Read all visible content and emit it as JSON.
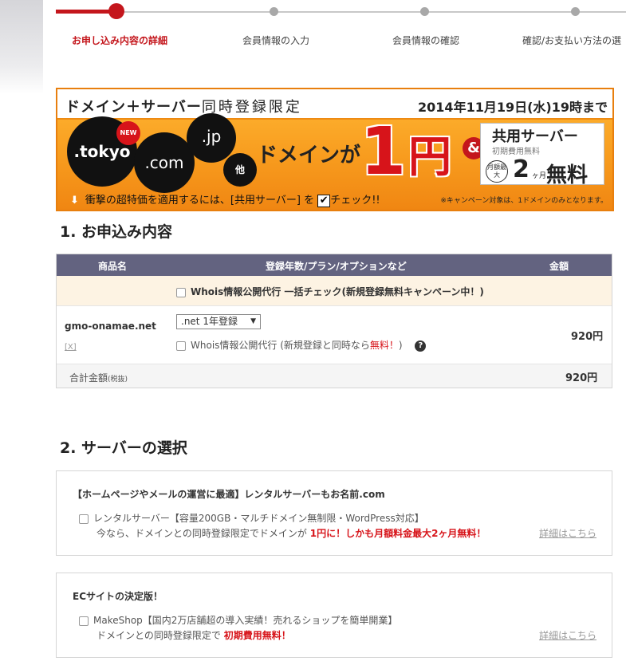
{
  "steps": [
    {
      "label": "お申し込み内容の詳細",
      "active": true
    },
    {
      "label": "会員情報の入力",
      "active": false
    },
    {
      "label": "会員情報の確認",
      "active": false
    },
    {
      "label": "確認/お支払い方法の選",
      "active": false
    }
  ],
  "banner": {
    "headline": "ドメイン＋サーバー",
    "limited": "同時登録限定",
    "date": "2014年11月19日(水)19時まで",
    "new_badge": "NEW",
    "tlds": [
      ".tokyo",
      ".com",
      ".jp",
      "他"
    ],
    "domain_ga": "ドメインが",
    "price_one": "1",
    "price_yen": "円",
    "amp": "&",
    "server_title": "共用サーバー",
    "server_sub": "初期費用無料",
    "monthly": "月額最大",
    "two": "2",
    "months": "ヶ月",
    "free": "無料",
    "bottom_text": "衝撃の超特価を適用するには、[共用サーバー] を",
    "check_text": "チェック!!",
    "note": "※キャンペーン対象は、1ドメインのみとなります。"
  },
  "section1": {
    "title": "1. お申込み内容",
    "headers": {
      "product": "商品名",
      "plan": "登録年数/プラン/オプションなど",
      "price": "金額"
    },
    "bulk_label": "Whois情報公開代行 一括チェック(新規登録無料キャンペーン中！)",
    "item": {
      "domain": "gmo-onamae.net",
      "remove": "[X]",
      "plan_selected": ".net 1年登録",
      "whois_label_pre": "Whois情報公開代行 (新規登録と同時なら",
      "whois_free": "無料！",
      "whois_label_post": ")",
      "price": "920円"
    },
    "total_label": "合計金額",
    "total_note": "(税抜)",
    "total_price": "920円"
  },
  "section2": {
    "title": "2. サーバーの選択",
    "boxes": [
      {
        "heading": "【ホームページやメールの運営に最適】レンタルサーバーもお名前.com",
        "option": "レンタルサーバー【容量200GB・マルチドメイン無制限・WordPress対応】",
        "promo_pre": "今なら、ドメインとの同時登録限定でドメインが",
        "promo_red": "1円に！しかも月額料金最大2ヶ月無料！",
        "detail_link": "詳細はこちら"
      },
      {
        "heading": "ECサイトの決定版！",
        "option": "MakeShop【国内2万店舗超の導入実績！売れるショップを簡単開業】",
        "promo_pre": "ドメインとの同時登録限定で",
        "promo_red": "初期費用無料！",
        "detail_link": "詳細はこちら"
      }
    ]
  },
  "colors": {
    "accent": "#c4161c",
    "header_bg": "#636380",
    "banner_orange": "#f79a1d"
  }
}
